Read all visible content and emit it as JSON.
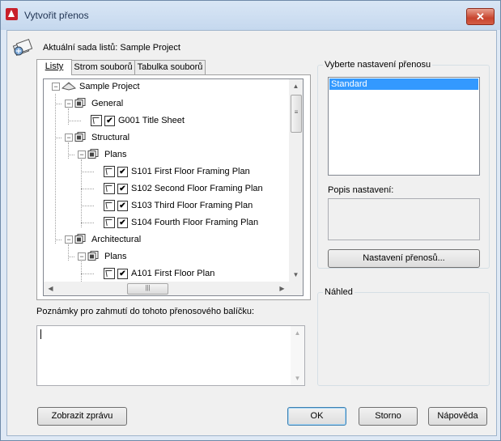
{
  "window": {
    "title": "Vytvořit přenos",
    "close_label": "✕"
  },
  "current_sheet_set": "Aktuální sada listů: Sample Project",
  "tabs": [
    {
      "label": "Listy",
      "active": true
    },
    {
      "label": "Strom souborů",
      "active": false
    },
    {
      "label": "Tabulka souborů",
      "active": false
    }
  ],
  "tree": {
    "root": "Sample Project",
    "general": "General",
    "g001": "G001 Title Sheet",
    "structural": "Structural",
    "plans1": "Plans",
    "s101": "S101 First Floor Framing Plan",
    "s102": "S102 Second Floor Framing Plan",
    "s103": "S103 Third Floor Framing Plan",
    "s104": "S104 Fourth Floor Framing Plan",
    "architectural": "Architectural",
    "plans2": "Plans",
    "a101": "A101 First Floor Plan"
  },
  "notes": {
    "label": "Poznámky pro zahmutí do tohoto přenosového balíčku:",
    "value": ""
  },
  "setup_group": {
    "title": "Vyberte nastavení přenosu",
    "options": [
      "Standard"
    ],
    "selected": "Standard",
    "description_label": "Popis nastavení:",
    "setup_button": "Nastavení přenosů..."
  },
  "preview": {
    "title": "Náhled"
  },
  "buttons": {
    "view_report": "Zobrazit zprávu",
    "ok": "OK",
    "cancel": "Storno",
    "help": "Nápověda"
  },
  "colors": {
    "selection": "#3399ff",
    "close_button": "#c8442e",
    "title_bar": "#c5d8ee"
  }
}
